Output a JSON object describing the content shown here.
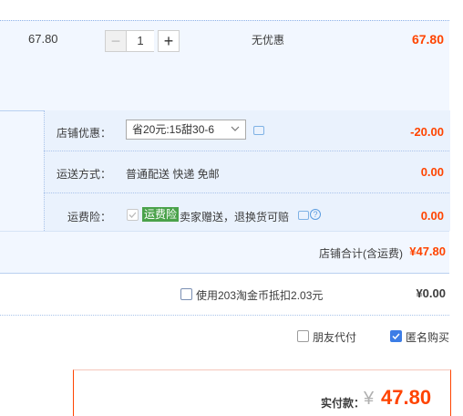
{
  "item": {
    "unit_price": "67.80",
    "quantity": "1",
    "minus": "−",
    "plus": "+",
    "discount": "无优惠",
    "subtotal": "67.80"
  },
  "shop_coupon": {
    "label": "店铺优惠：",
    "selected": "省20元:15甜30-6",
    "amount": "-20.00"
  },
  "shipping": {
    "label": "运送方式：",
    "value": "普通配送 快递 免邮",
    "amount": "0.00"
  },
  "insurance": {
    "label": "运费险：",
    "tag": "运费险",
    "value": "卖家赠送，退换货可赔",
    "help": "?",
    "amount": "0.00"
  },
  "shop_total": {
    "label": "店铺合计(含运费)",
    "amount": "¥47.80"
  },
  "coin": {
    "label": "使用203淘金币抵扣2.03元",
    "amount": "¥0.00"
  },
  "pay_options": {
    "friend_pay": "朋友代付",
    "anonymous": "匿名购买"
  },
  "final": {
    "label": "实付款：",
    "currency": "¥",
    "amount": "47.80"
  },
  "colors": {
    "price_red": "#ff4400",
    "panel_blue": "#f2f7ff",
    "tag_green": "#4aa24a",
    "check_blue": "#3c7de6"
  }
}
